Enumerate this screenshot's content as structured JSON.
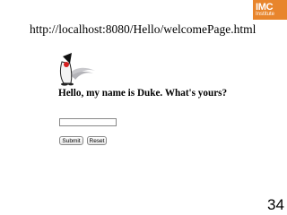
{
  "slide": {
    "url": "http://localhost:8080/Hello/welcomePage.html",
    "page_number": "34"
  },
  "logo": {
    "title": "IMC",
    "subtitle": "Institute",
    "color": "#e8852c"
  },
  "page": {
    "mascot_icon": "duke-mascot-icon",
    "greeting": "Hello, my name is Duke. What's yours?",
    "name_input": {
      "value": "",
      "placeholder": ""
    },
    "submit_label": "Submit",
    "reset_label": "Reset"
  }
}
